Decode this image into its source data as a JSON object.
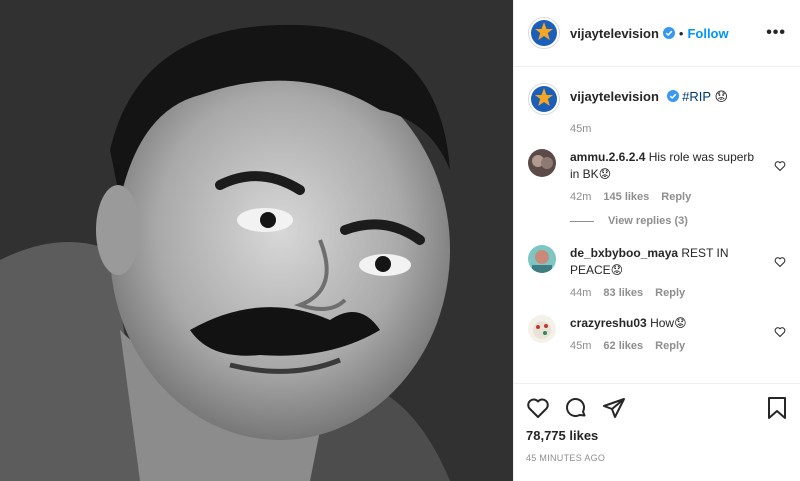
{
  "header": {
    "username": "vijaytelevision",
    "dot": "•",
    "follow_label": "Follow",
    "more_label": "•••"
  },
  "caption": {
    "username": "vijaytelevision",
    "hashtag": "#RIP",
    "emoji": "😟",
    "time": "45m"
  },
  "comments": [
    {
      "username": "ammu.2.6.2.4",
      "text": "His role was superb in BK😟",
      "time": "42m",
      "likes": "145 likes",
      "reply": "Reply"
    },
    {
      "username": "de_bxbyboo_maya",
      "text": "REST IN PEACE😟",
      "time": "44m",
      "likes": "83 likes",
      "reply": "Reply"
    },
    {
      "username": "crazyreshu03",
      "text": "How😟",
      "time": "45m",
      "likes": "62 likes",
      "reply": "Reply"
    }
  ],
  "view_replies": "View replies (3)",
  "footer": {
    "likes": "78,775 likes",
    "ago": "45 MINUTES AGO"
  },
  "colors": {
    "link": "#0095f6",
    "verified": "#3897f0",
    "muted": "#8e8e8e",
    "brand_star": "#f5a623",
    "brand_blue": "#1b5fb8"
  },
  "icons": [
    "heart-icon",
    "comment-icon",
    "share-icon",
    "bookmark-icon",
    "verified-badge-icon",
    "more-options-icon"
  ]
}
